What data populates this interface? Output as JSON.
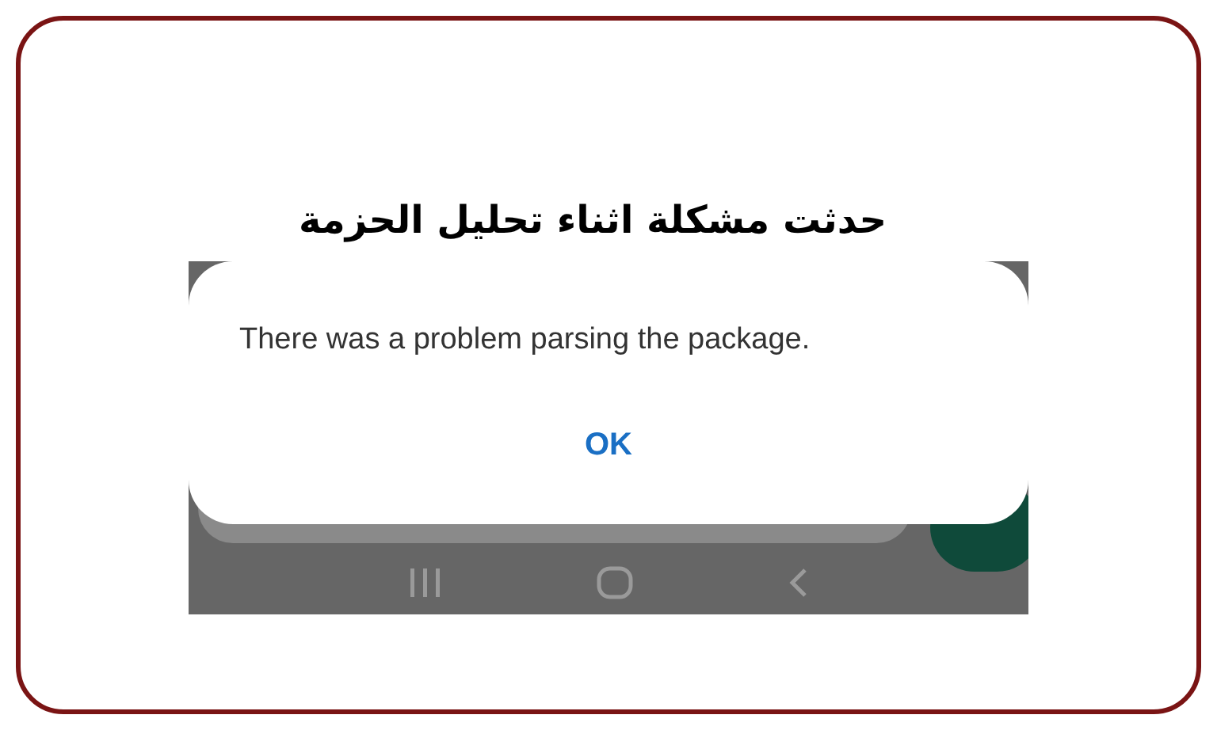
{
  "heading": "حدثت مشكلة اثناء تحليل الحزمة",
  "dialog": {
    "message": "There was a problem parsing the package.",
    "buttons": [
      {
        "label": "OK"
      }
    ]
  }
}
